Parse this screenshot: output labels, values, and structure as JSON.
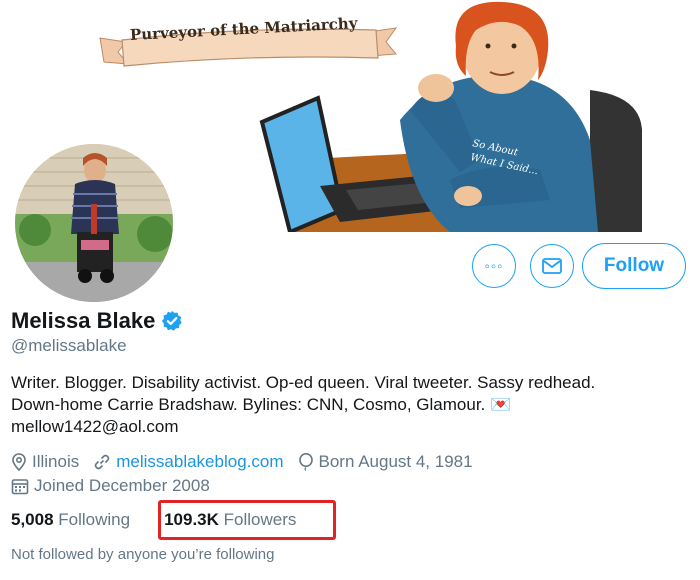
{
  "banner": {
    "ribbon_text": "Purveyor of the Matriarchy",
    "shirt_text_line1": "So About",
    "shirt_text_line2": "What I Said..."
  },
  "actions": {
    "more_icon": "more-horizontal-icon",
    "message_icon": "envelope-icon",
    "follow_label": "Follow"
  },
  "profile": {
    "name": "Melissa Blake",
    "verified_icon": "verified-badge-icon",
    "handle": "@melissablake",
    "bio_line1": "Writer. Blogger. Disability activist. Op-ed queen. Viral tweeter. Sassy redhead.",
    "bio_line2": "Down-home Carrie Bradshaw. Bylines: CNN, Cosmo, Glamour. 💌",
    "bio_line3": "mellow1422@aol.com",
    "location": "Illinois",
    "website": "melissablakeblog.com",
    "birthday": "Born August 4, 1981",
    "joined": "Joined December 2008"
  },
  "stats": {
    "following_count": "5,008",
    "following_label": "Following",
    "followers_count": "109.3K",
    "followers_label": "Followers"
  },
  "social_context": "Not followed by anyone you’re following",
  "colors": {
    "accent": "#1da1f2",
    "link": "#1b95e0",
    "muted": "#657786",
    "highlight_box": "#e02424"
  }
}
